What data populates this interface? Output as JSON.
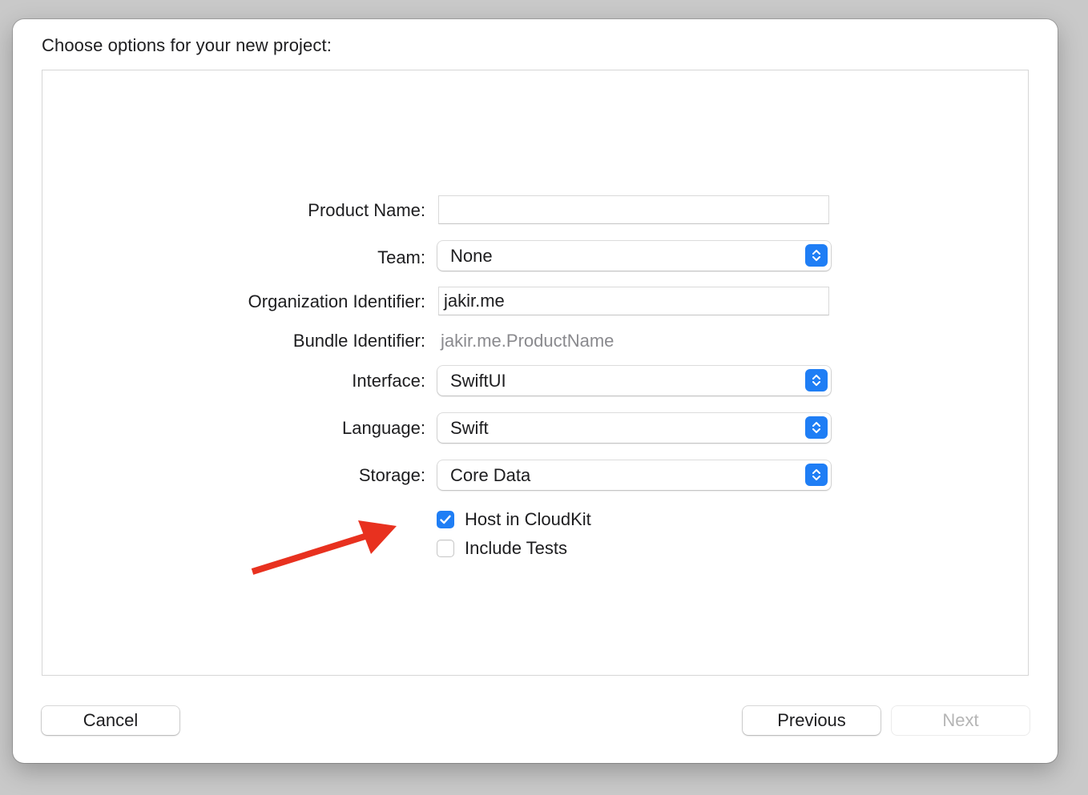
{
  "dialog": {
    "title": "Choose options for your new project:"
  },
  "form": {
    "product_name": {
      "label": "Product Name:",
      "value": ""
    },
    "team": {
      "label": "Team:",
      "value": "None"
    },
    "organization_identifier": {
      "label": "Organization Identifier:",
      "value": "jakir.me"
    },
    "bundle_identifier": {
      "label": "Bundle Identifier:",
      "value": "jakir.me.ProductName"
    },
    "interface": {
      "label": "Interface:",
      "value": "SwiftUI"
    },
    "language": {
      "label": "Language:",
      "value": "Swift"
    },
    "storage": {
      "label": "Storage:",
      "value": "Core Data"
    },
    "checkboxes": [
      {
        "label": "Host in CloudKit",
        "checked": true
      },
      {
        "label": "Include Tests",
        "checked": false
      }
    ]
  },
  "footer": {
    "cancel_label": "Cancel",
    "previous_label": "Previous",
    "next_label": "Next"
  },
  "colors": {
    "accent": "#1f7ef5",
    "annotation_arrow": "#e8311f"
  },
  "icons": {
    "popup_stepper": "chevron-up-down-icon",
    "checkmark": "checkmark-icon",
    "annotation": "arrow-icon"
  }
}
